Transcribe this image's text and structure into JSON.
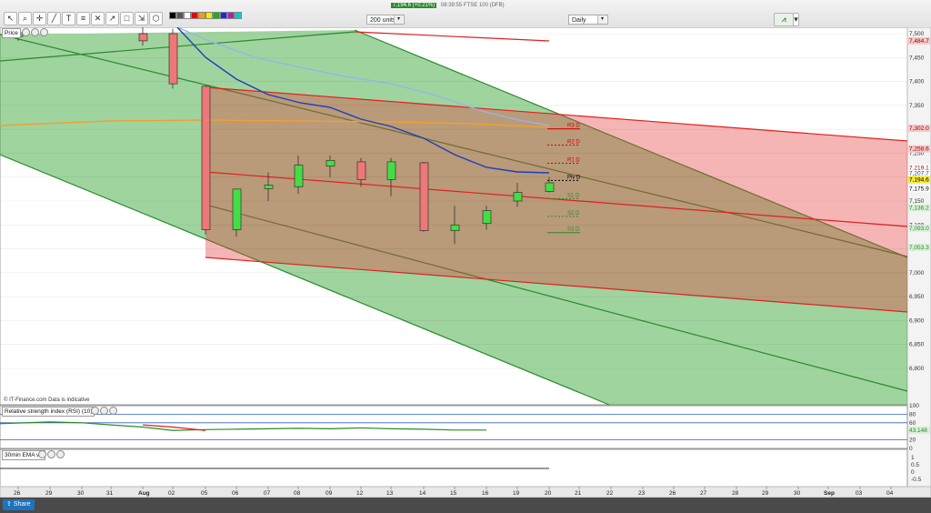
{
  "toolbar": {
    "ticker": {
      "price": "7,194.6 (+0.21%)",
      "text": "08:39:55 FTSE 100 (DFB)"
    },
    "units_select": "200 units",
    "interval_select": "Daily"
  },
  "panels": {
    "price_label": "Price",
    "rsi_label": "Relative strength index (RSI) (10)",
    "ema_label": "30min EMA v2",
    "copyright": "© IT-Finance.com  Data is indicative"
  },
  "share_label": "Share",
  "chart_data": {
    "type": "candlestick",
    "y_ticks": [
      "7,500",
      "7,450",
      "7,400",
      "7,350",
      "7,300",
      "7,250",
      "7,200",
      "7,150",
      "7,100",
      "7,050",
      "7,000",
      "6,950",
      "6,900",
      "6,850",
      "6,800"
    ],
    "y_range": [
      6740,
      7520
    ],
    "x_labels": [
      "26",
      "29",
      "30",
      "31",
      "Aug",
      "02",
      "05",
      "06",
      "07",
      "08",
      "09",
      "12",
      "13",
      "14",
      "15",
      "16",
      "19",
      "20",
      "21",
      "22",
      "23",
      "26",
      "27",
      "28",
      "29",
      "30",
      "Sep",
      "03",
      "04"
    ],
    "candles": [
      {
        "date": "26",
        "open": 7494,
        "high": 7505,
        "low": 7485,
        "close": 7502
      },
      {
        "date": "01",
        "open": 7500,
        "high": 7515,
        "low": 7475,
        "close": 7485
      },
      {
        "date": "02",
        "open": 7500,
        "high": 7510,
        "low": 7385,
        "close": 7395
      },
      {
        "date": "05",
        "open": 7390,
        "high": 7392,
        "low": 7080,
        "close": 7090
      },
      {
        "date": "06",
        "open": 7090,
        "high": 7140,
        "low": 7075,
        "close": 7175
      },
      {
        "date": "07",
        "open": 7176,
        "high": 7210,
        "low": 7150,
        "close": 7183
      },
      {
        "date": "08",
        "open": 7180,
        "high": 7245,
        "low": 7165,
        "close": 7225
      },
      {
        "date": "09",
        "open": 7223,
        "high": 7245,
        "low": 7200,
        "close": 7235
      },
      {
        "date": "12",
        "open": 7232,
        "high": 7240,
        "low": 7180,
        "close": 7195
      },
      {
        "date": "13",
        "open": 7195,
        "high": 7240,
        "low": 7160,
        "close": 7232
      },
      {
        "date": "14",
        "open": 7230,
        "high": 7232,
        "low": 7085,
        "close": 7088
      },
      {
        "date": "15",
        "open": 7088,
        "high": 7140,
        "low": 7060,
        "close": 7100
      },
      {
        "date": "16",
        "open": 7103,
        "high": 7140,
        "low": 7090,
        "close": 7130
      },
      {
        "date": "19",
        "open": 7150,
        "high": 7188,
        "low": 7138,
        "close": 7168
      },
      {
        "date": "20",
        "open": 7170,
        "high": 7200,
        "low": 7168,
        "close": 7188
      }
    ],
    "pivot_levels": [
      {
        "name": "R3 D",
        "value": 7301,
        "color": "#d40000",
        "style": "solid"
      },
      {
        "name": "R2 D",
        "value": 7267,
        "color": "#d40000",
        "style": "dashed"
      },
      {
        "name": "R1 D",
        "value": 7229,
        "color": "#d40000",
        "style": "dashed"
      },
      {
        "name": "Piv D",
        "value": 7193,
        "color": "#000000",
        "style": "dashed"
      },
      {
        "name": "S1 D",
        "value": 7155,
        "color": "#2b8a2b",
        "style": "dashed"
      },
      {
        "name": "S2 D",
        "value": 7118,
        "color": "#2b8a2b",
        "style": "dashed"
      },
      {
        "name": "S3 D",
        "value": 7084,
        "color": "#2b8a2b",
        "style": "solid"
      }
    ],
    "right_labels": [
      {
        "text": "7,484.7",
        "value": 7485,
        "bg": "#f4c9c9",
        "color": "#a00000"
      },
      {
        "text": "7,302.0",
        "value": 7302,
        "bg": "#f4c9c9",
        "color": "#a00000"
      },
      {
        "text": "7,258.6",
        "value": 7259,
        "bg": "#f4c9c9",
        "color": "#a00000"
      },
      {
        "text": "7,219.1",
        "value": 7219,
        "bg": "#ffffff",
        "color": "#a00000"
      },
      {
        "text": "7,207.7",
        "value": 7208,
        "bg": "#ffffff",
        "color": "#1a3fbf"
      },
      {
        "text": "7,194.6",
        "value": 7195,
        "bg": "#f7e83c",
        "color": "#000000"
      },
      {
        "text": "7,175.9",
        "value": 7176,
        "bg": "#ffffff",
        "color": "#000000"
      },
      {
        "text": "7,136.2",
        "value": 7136,
        "bg": "#d8efd8",
        "color": "#2b8a2b"
      },
      {
        "text": "7,093.0",
        "value": 7093,
        "bg": "#d8efd8",
        "color": "#2b8a2b"
      },
      {
        "text": "7,053.3",
        "value": 7053,
        "bg": "#d8efd8",
        "color": "#2b8a2b"
      }
    ],
    "rsi": {
      "y_ticks": [
        "100",
        "80",
        "60",
        "20",
        "0"
      ],
      "value_label": "43.148",
      "values": [
        58,
        62,
        60,
        55,
        50,
        42,
        44,
        45,
        46,
        47,
        46,
        48,
        46,
        45,
        43,
        43
      ]
    },
    "ema_panel": {
      "y_ticks": [
        "1",
        "0.5",
        "0",
        "-0.5"
      ]
    }
  },
  "colors": {
    "bull": "#44dd44",
    "bear": "#ee7777",
    "green_channel": "#2b8a2b",
    "red_channel": "#e02020",
    "ema_fast": "#1a3fbf",
    "ema_slow": "#9ab3e6",
    "ema_long": "#f0a030"
  }
}
